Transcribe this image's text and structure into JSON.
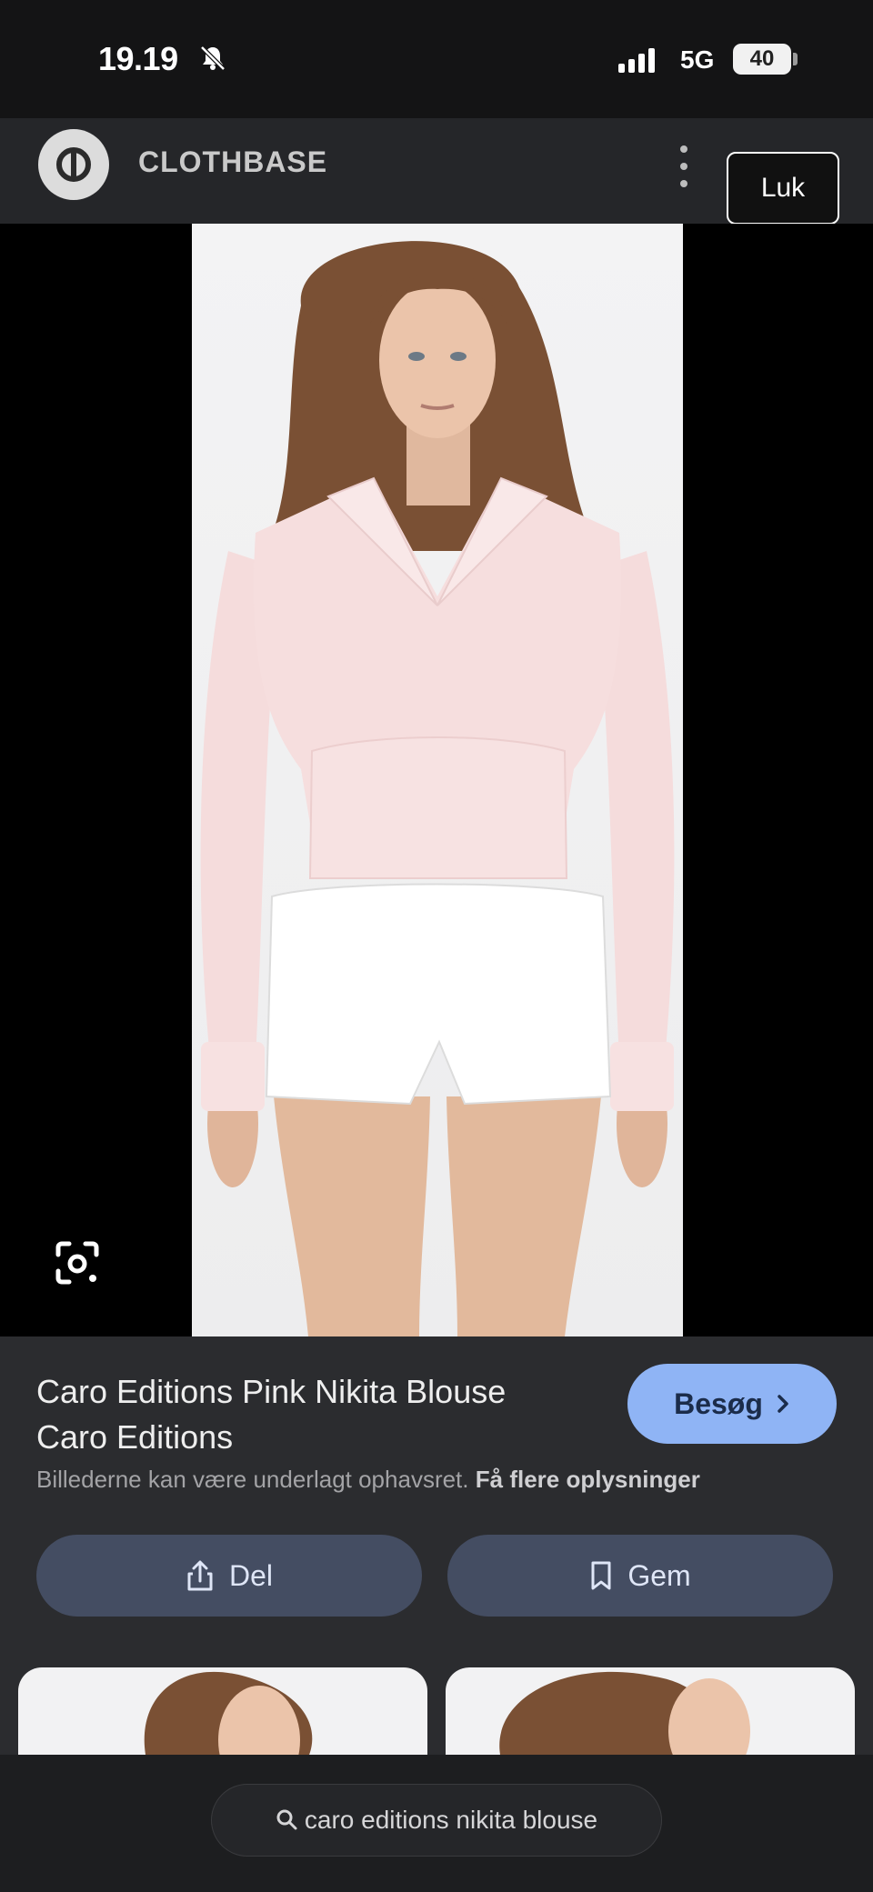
{
  "status_bar": {
    "time": "19.19",
    "network": "5G",
    "battery": "40",
    "icons": [
      "bell-muted-icon",
      "signal-icon",
      "battery-icon"
    ]
  },
  "site_header": {
    "site_name": "CLOTHBASE",
    "icons": [
      "site-logo-icon",
      "more-vertical-icon",
      "close-icon"
    ]
  },
  "close_label": "Luk",
  "result": {
    "title_line1": "Caro Editions Pink Nikita Blouse",
    "title_line2": "Caro Editions",
    "visit_label": "Besøg",
    "copyright_text": "Billederne kan være underlagt ophavsret.",
    "more_info_label": "Få flere oplysninger",
    "share_label": "Del",
    "save_label": "Gem"
  },
  "bottom_search": {
    "query": "caro editions nikita blouse"
  },
  "colors": {
    "accent_button": "#8fb4f5",
    "action_button": "#444d62",
    "panel": "#2b2c2f",
    "header": "#252629"
  }
}
